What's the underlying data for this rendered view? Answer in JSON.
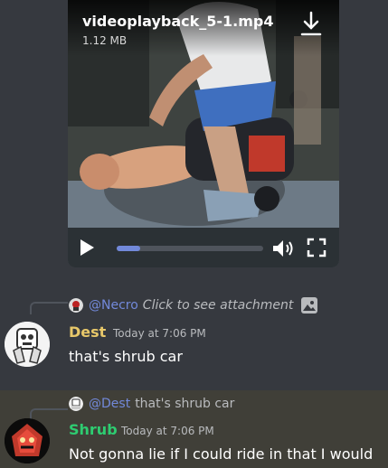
{
  "attachment": {
    "filename": "videoplayback_5-1.mp4",
    "size": "1.12 MB",
    "progress": 0.16
  },
  "messages": [
    {
      "reply_to": {
        "mention": "@Necro",
        "text": "Click to see attachment"
      },
      "author": "Dest",
      "author_color": "#e8c86a",
      "timestamp": "Today at 7:06 PM",
      "content": "that's shrub car"
    },
    {
      "reply_to": {
        "mention": "@Dest",
        "text": "that's shrub car"
      },
      "author": "Shrub",
      "author_color": "#2ecc71",
      "timestamp": "Today at 7:06 PM",
      "content": "Not gonna lie if I could ride in that I would"
    }
  ],
  "colors": {
    "background": "#36393f",
    "mention": "#7289da",
    "highlight": "#403f38"
  }
}
